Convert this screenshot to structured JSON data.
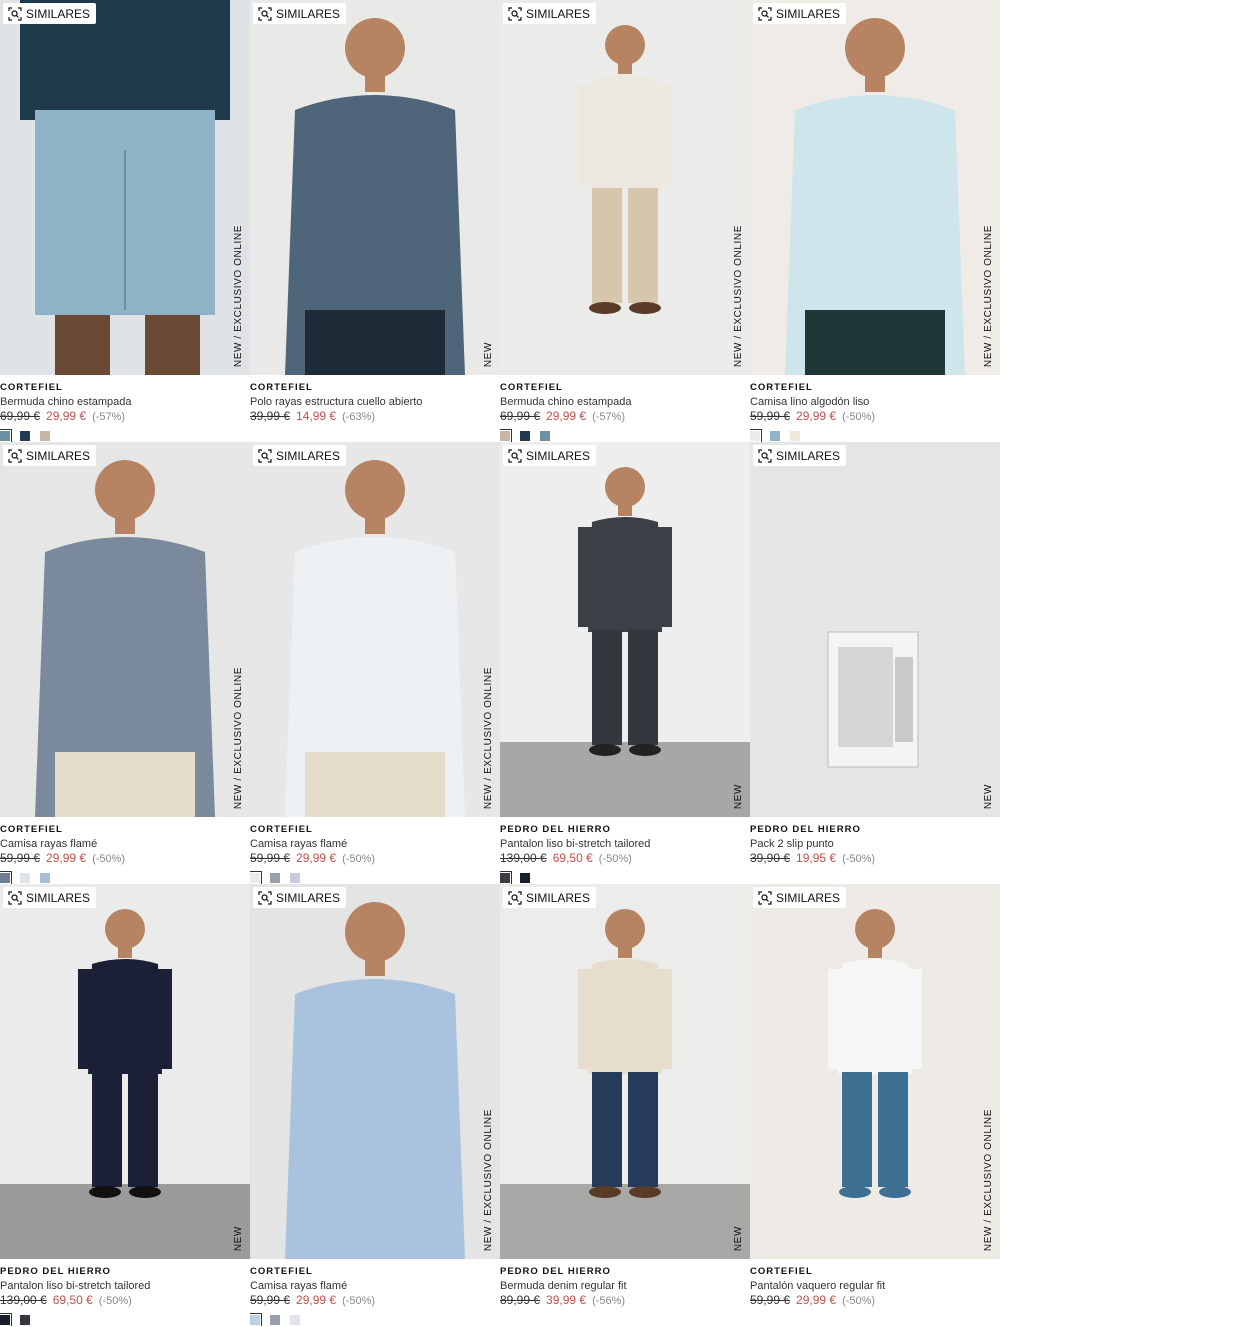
{
  "ui": {
    "similar_label": "SIMILARES",
    "new_label": "NEW",
    "exclusive_label": "NEW  /  EXCLUSIVO ONLINE"
  },
  "products": [
    {
      "brand": "CORTEFIEL",
      "name": "Bermuda chino estampada",
      "old_price": "69,99 €",
      "price": "29,99 €",
      "discount": "(-57%)",
      "exclusive": true,
      "swatches": [
        "#6f8fa3",
        "#1f3a52",
        "#c8b5a2"
      ],
      "bg": "#dfe3e6",
      "top": "#1f3a4a",
      "bottom": "#8fb2c7",
      "legs": "#6b4a35",
      "pose": "crop"
    },
    {
      "brand": "CORTEFIEL",
      "name": "Polo rayas estructura cuello abierto",
      "old_price": "39,99 €",
      "price": "14,99 €",
      "discount": "(-63%)",
      "exclusive": false,
      "swatches": [],
      "bg": "#e9e9e7",
      "top": "#4f6579",
      "bottom": "#1d2b36",
      "legs": "#1d2b36",
      "pose": "upper"
    },
    {
      "brand": "CORTEFIEL",
      "name": "Bermuda chino estampada",
      "old_price": "69,99 €",
      "price": "29,99 €",
      "discount": "(-57%)",
      "exclusive": true,
      "swatches": [
        "#c8b5a2",
        "#1f3a52",
        "#6f8fa3"
      ],
      "bg": "#ebebea",
      "top": "#ede8df",
      "bottom": "#d6c6ac",
      "legs": "#5a3b28",
      "pose": "full"
    },
    {
      "brand": "CORTEFIEL",
      "name": "Camisa lino algodón liso",
      "old_price": "59,99 €",
      "price": "29,99 €",
      "discount": "(-50%)",
      "exclusive": true,
      "swatches": [
        "#e8ecef",
        "#8fb3c8",
        "#ede8dd"
      ],
      "bg": "#efebe6",
      "top": "#cfe5ec",
      "bottom": "#1f3636",
      "legs": "#1f3636",
      "pose": "upper"
    },
    {
      "brand": "CORTEFIEL",
      "name": "Camisa rayas flamé",
      "old_price": "59,99 €",
      "price": "29,99 €",
      "discount": "(-50%)",
      "exclusive": true,
      "swatches": [
        "#6f7f92",
        "#dfe3ea",
        "#a9bdd6"
      ],
      "bg": "#e6e6e6",
      "top": "#7a8a9c",
      "bottom": "#e6dccc",
      "legs": "#e6dccc",
      "pose": "upper"
    },
    {
      "brand": "CORTEFIEL",
      "name": "Camisa rayas flamé",
      "old_price": "59,99 €",
      "price": "29,99 €",
      "discount": "(-50%)",
      "exclusive": true,
      "swatches": [
        "#e8ecef",
        "#9aa0aa",
        "#c6cbe0"
      ],
      "bg": "#e7e7e7",
      "top": "#eef1f4",
      "bottom": "#e6dccc",
      "legs": "#e6dccc",
      "pose": "upper"
    },
    {
      "brand": "PEDRO DEL HIERRO",
      "name": "Pantalon liso bi-stretch tailored",
      "old_price": "139,00 €",
      "price": "69,50 €",
      "discount": "(-50%)",
      "exclusive": false,
      "swatches": [
        "#3a3d42",
        "#1a1f2e"
      ],
      "bg": "#eeeeee",
      "top": "#3b3f46",
      "bottom": "#34373d",
      "legs": "#222",
      "pose": "full",
      "floor": "#a7a7a5"
    },
    {
      "brand": "PEDRO DEL HIERRO",
      "name": "Pack 2 slip punto",
      "old_price": "39,90 €",
      "price": "19,95 €",
      "discount": "(-50%)",
      "exclusive": false,
      "swatches": [],
      "bg": "#e5e5e3",
      "pose": "box"
    },
    {
      "brand": "PEDRO DEL HIERRO",
      "name": "Pantalon liso bi-stretch tailored",
      "old_price": "139,00 €",
      "price": "69,50 €",
      "discount": "(-50%)",
      "exclusive": false,
      "swatches": [
        "#1a1f2e",
        "#34373d"
      ],
      "bg": "#ebebeb",
      "top": "#1b2036",
      "bottom": "#1b2036",
      "legs": "#111",
      "pose": "full",
      "floor": "#9b9b99"
    },
    {
      "brand": "CORTEFIEL",
      "name": "Camisa rayas flamé",
      "old_price": "59,99 €",
      "price": "29,99 €",
      "discount": "(-50%)",
      "exclusive": true,
      "swatches": [
        "#bcd1e2",
        "#9aa0aa",
        "#dfe3ea"
      ],
      "bg": "#e4e4e4",
      "top": "#a9c3de",
      "bottom": "#a9c3de",
      "legs": "#a9c3de",
      "pose": "upper"
    },
    {
      "brand": "PEDRO DEL HIERRO",
      "name": "Bermuda denim regular fit",
      "old_price": "89,99 €",
      "price": "39,99 €",
      "discount": "(-56%)",
      "exclusive": false,
      "swatches": [],
      "bg": "#ececea",
      "top": "#e6ddcc",
      "bottom": "#263a5a",
      "legs": "#5a3b28",
      "pose": "full",
      "floor": "#a8a8a6"
    },
    {
      "brand": "CORTEFIEL",
      "name": "Pantalón vaquero regular fit",
      "old_price": "59,99 €",
      "price": "29,99 €",
      "discount": "(-50%)",
      "exclusive": true,
      "swatches": [],
      "bg": "#eeebe6",
      "top": "#f6f6f6",
      "bottom": "#3c6f92",
      "legs": "#3c6f92",
      "pose": "full"
    }
  ]
}
